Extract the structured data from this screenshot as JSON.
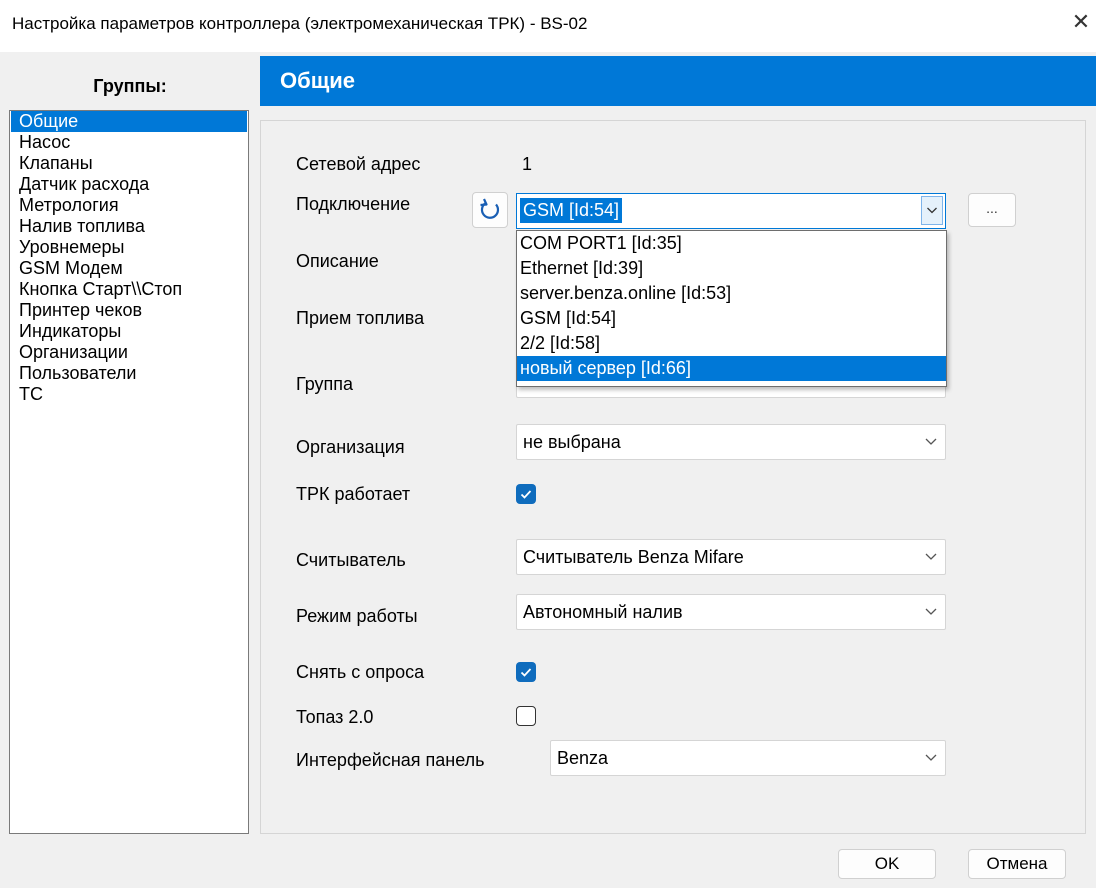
{
  "window": {
    "title": "Настройка параметров контроллера (электромеханическая ТРК) - BS-02",
    "close_glyph": "✕"
  },
  "groups": {
    "header": "Группы:",
    "items": [
      {
        "label": "Общие",
        "selected": true
      },
      {
        "label": "Насос"
      },
      {
        "label": "Клапаны"
      },
      {
        "label": "Датчик расхода"
      },
      {
        "label": "Метрология"
      },
      {
        "label": "Налив топлива"
      },
      {
        "label": "Уровнемеры"
      },
      {
        "label": "GSM Модем"
      },
      {
        "label": "Кнопка Старт\\\\Стоп"
      },
      {
        "label": "Принтер чеков"
      },
      {
        "label": "Индикаторы"
      },
      {
        "label": "Организации"
      },
      {
        "label": "Пользователи"
      },
      {
        "label": "ТС"
      }
    ]
  },
  "section": {
    "title": "Общие"
  },
  "form": {
    "network_address": {
      "label": "Сетевой адрес",
      "value": "1"
    },
    "connection": {
      "label": "Подключение",
      "value": "GSM [Id:54]",
      "refresh_icon": "refresh-icon",
      "browse_label": "...",
      "options": [
        "COM PORT1 [Id:35]",
        "Ethernet [Id:39]",
        "server.benza.online [Id:53]",
        "GSM [Id:54]",
        "2/2 [Id:58]",
        "новый сервер [Id:66]"
      ],
      "highlighted_option": "новый сервер [Id:66]"
    },
    "description": {
      "label": "Описание"
    },
    "fuel_reception": {
      "label": "Прием топлива"
    },
    "group": {
      "label": "Группа"
    },
    "organization": {
      "label": "Организация",
      "value": "не выбрана"
    },
    "trk_works": {
      "label": "ТРК работает",
      "checked": true
    },
    "reader": {
      "label": "Считыватель",
      "value": "Считыватель Benza Mifare"
    },
    "mode": {
      "label": "Режим работы",
      "value": "Автономный налив"
    },
    "remove_poll": {
      "label": "Снять с опроса",
      "checked": true
    },
    "topaz": {
      "label": "Топаз 2.0",
      "checked": false
    },
    "interface_panel": {
      "label": "Интерфейсная панель",
      "value": "Benza"
    }
  },
  "buttons": {
    "ok": "OK",
    "cancel": "Отмена"
  },
  "colors": {
    "accent": "#0078d7",
    "checkbox": "#0f6cbd"
  }
}
